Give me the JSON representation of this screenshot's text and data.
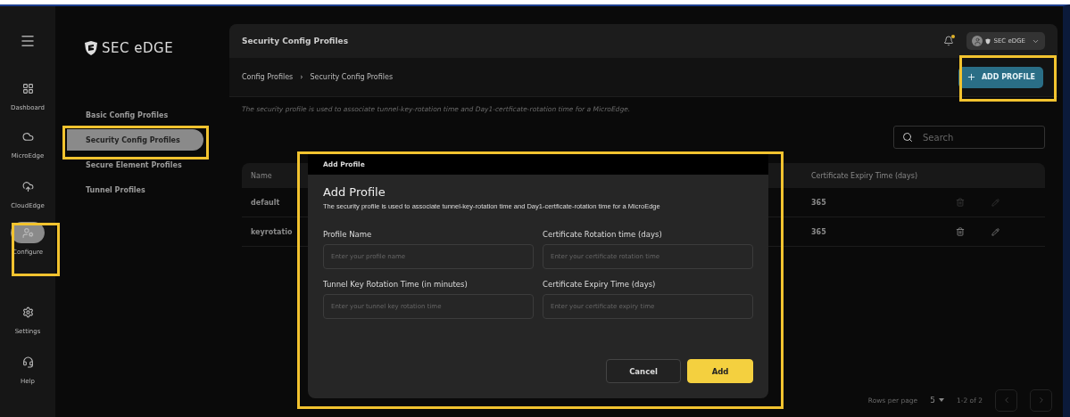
{
  "rail": {
    "items": [
      {
        "label": "Dashboard",
        "selected": false
      },
      {
        "label": "MicroEdge",
        "selected": false
      },
      {
        "label": "CloudEdge",
        "selected": false
      },
      {
        "label": "Configure",
        "selected": true
      },
      {
        "label": "Settings",
        "selected": false
      },
      {
        "label": "Help",
        "selected": false
      }
    ]
  },
  "brand": {
    "name": "SEC eDGE"
  },
  "subnav": {
    "items": [
      {
        "label": "Basic Config Profiles",
        "selected": false
      },
      {
        "label": "Security Config Profiles",
        "selected": true
      },
      {
        "label": "Secure Element Profiles",
        "selected": false
      },
      {
        "label": "Tunnel Profiles",
        "selected": false
      }
    ]
  },
  "header": {
    "title": "Security Config Profiles",
    "notification": true,
    "user_brand": "SEC eDGE"
  },
  "breadcrumb": [
    "Config Profiles",
    "›",
    "Security Config Profiles"
  ],
  "add_button": "ADD PROFILE",
  "description": "The security profile is used to associate tunnel-key-rotation time and Day1-certficate-rotation time for a MicroEdge.",
  "search": {
    "placeholder": "Search"
  },
  "table": {
    "columns": [
      "Name",
      "Certificate Expiry Time (days)"
    ],
    "rows": [
      {
        "name": "default",
        "expiry": "365",
        "disabled": true
      },
      {
        "name": "keyrotatio",
        "expiry": "365",
        "disabled": false
      }
    ]
  },
  "pagination": {
    "rows_per_page_label": "Rows per page",
    "rows_per_page": "5",
    "range": "1-2 of 2"
  },
  "dialog": {
    "window_title": "Add Profile",
    "title": "Add Profile",
    "subtitle": "The security profile is used to associate tunnel-key-rotation time and Day1-certficate-rotation time for a MicroEdge",
    "fields": [
      {
        "label": "Profile Name",
        "placeholder": "Enter your profile name"
      },
      {
        "label": "Certificate Rotation time (days)",
        "placeholder": "Enter your certificate rotation time"
      },
      {
        "label": "Tunnel Key Rotation Time (in minutes)",
        "placeholder": "Enter your tunnel key rotation time"
      },
      {
        "label": "Certificate Expiry Time (days)",
        "placeholder": "Enter your certificate expiry time"
      }
    ],
    "buttons": [
      {
        "label": "Cancel",
        "kind": "secondary"
      },
      {
        "label": "Add",
        "kind": "primary"
      }
    ]
  }
}
